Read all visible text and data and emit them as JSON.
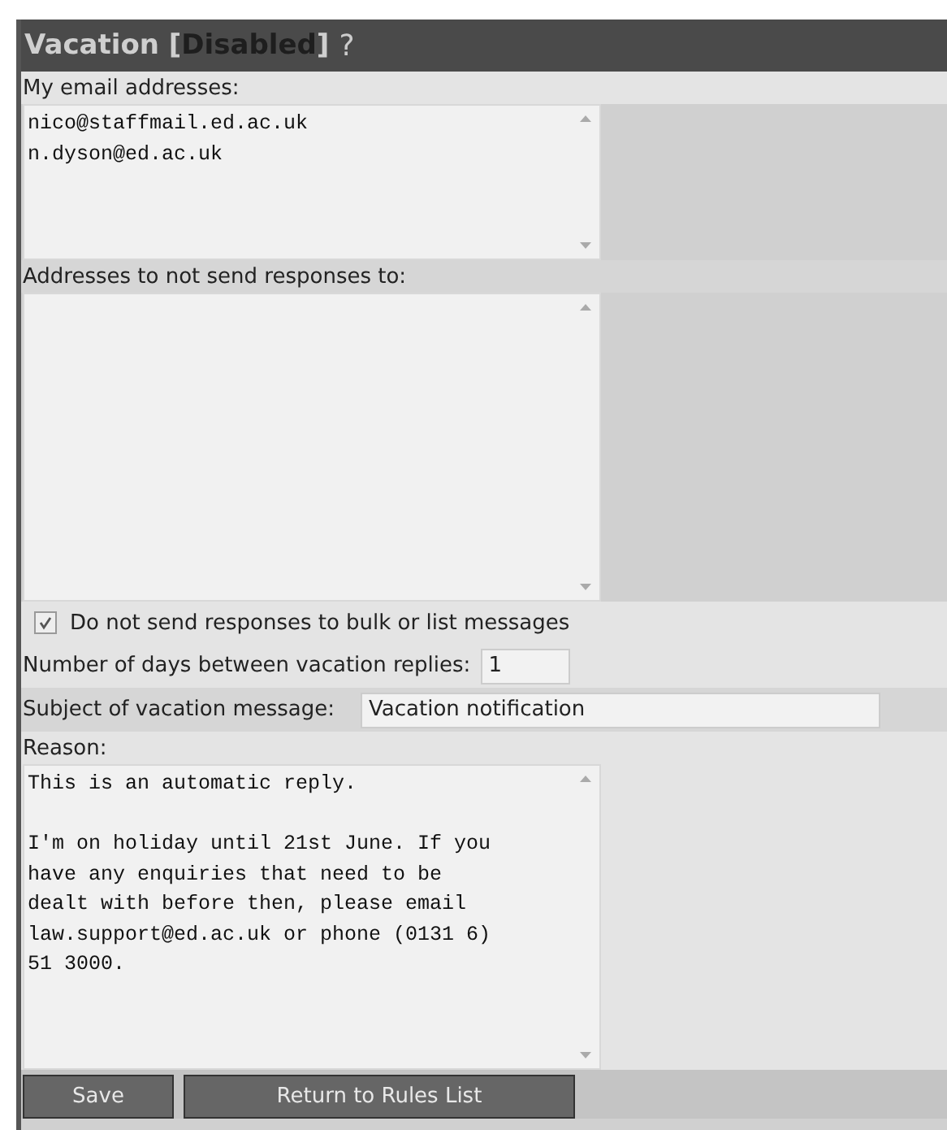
{
  "header": {
    "title": "Vacation [",
    "status": "Disabled",
    "status_end": "]",
    "help": "?"
  },
  "my_addresses": {
    "label": "My email addresses:",
    "value": "nico@staffmail.ed.ac.uk\nn.dyson@ed.ac.uk"
  },
  "excluded_addresses": {
    "label": "Addresses to not send responses to:"
  },
  "bulk": {
    "label": "Do not send responses to bulk or list messages",
    "checked": true
  },
  "days": {
    "label": "Number of days between vacation replies:",
    "value": "1"
  },
  "subject": {
    "label": "Subject of vacation message:",
    "value": "Vacation notification"
  },
  "reason": {
    "label": "Reason:",
    "value": "This is an automatic reply.\n\nI'm on holiday until 21st June. If you\nhave any enquiries that need to be\ndealt with before then, please email\nlaw.support@ed.ac.uk or phone (0131 6)\n51 3000."
  },
  "buttons": [
    {
      "label": "Save"
    },
    {
      "label": "Return to Rules List"
    }
  ]
}
